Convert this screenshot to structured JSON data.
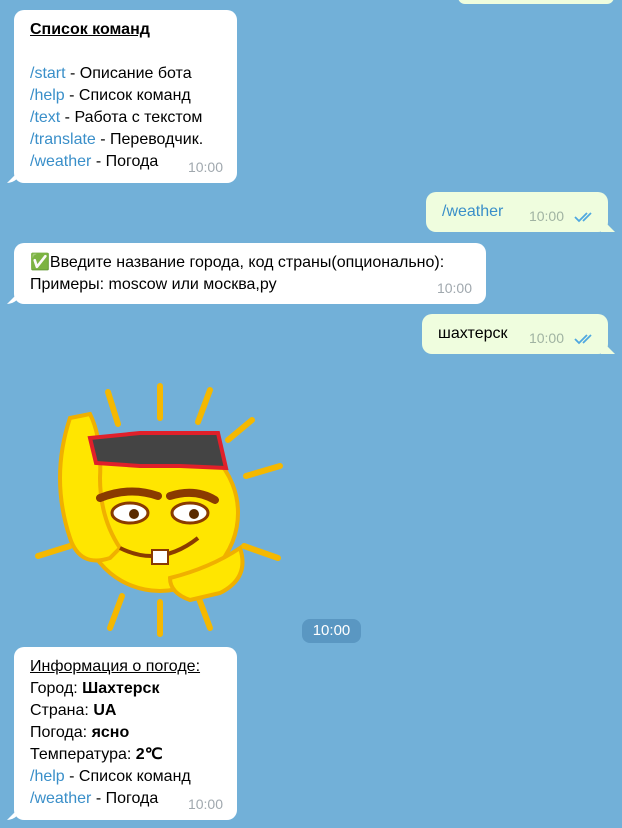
{
  "messages": {
    "m1": {
      "title": "Список команд",
      "commands": [
        {
          "cmd": "/start",
          "desc": " - Описание бота"
        },
        {
          "cmd": "/help",
          "desc": " - Список команд"
        },
        {
          "cmd": "/text",
          "desc": " - Работа с текстом"
        },
        {
          "cmd": "/translate",
          "desc": " - Переводчик."
        },
        {
          "cmd": "/weather",
          "desc": " - Погода"
        }
      ],
      "time": "10:00"
    },
    "m2": {
      "text": "/weather",
      "time": "10:00"
    },
    "m3": {
      "check_icon": "✅",
      "line1": "Введите название города, код страны(опционально):",
      "line2": "Примеры: moscow или москва,ру",
      "time": "10:00"
    },
    "m4": {
      "text": "шахтерск",
      "time": "10:00"
    },
    "sticker": {
      "icon": "sun-with-sunglasses-sticker",
      "time": "10:00"
    },
    "m5": {
      "title": "Информация о погоде:",
      "city_label": "Город: ",
      "city": "Шахтерск",
      "country_label": "Страна: ",
      "country": "UA",
      "weather_label": "Погода: ",
      "weather": "ясно",
      "temp_label": "Температура: ",
      "temp": "2℃",
      "help_cmd": "/help",
      "help_desc": " - Список команд",
      "weather_cmd": "/weather",
      "weather_desc": " - Погода",
      "time": "10:00"
    }
  },
  "colors": {
    "background": "#72b0d8",
    "link": "#3a8fc9",
    "incoming": "#ffffff",
    "outgoing": "#effdde",
    "read_checks": "#4fa8e0"
  }
}
